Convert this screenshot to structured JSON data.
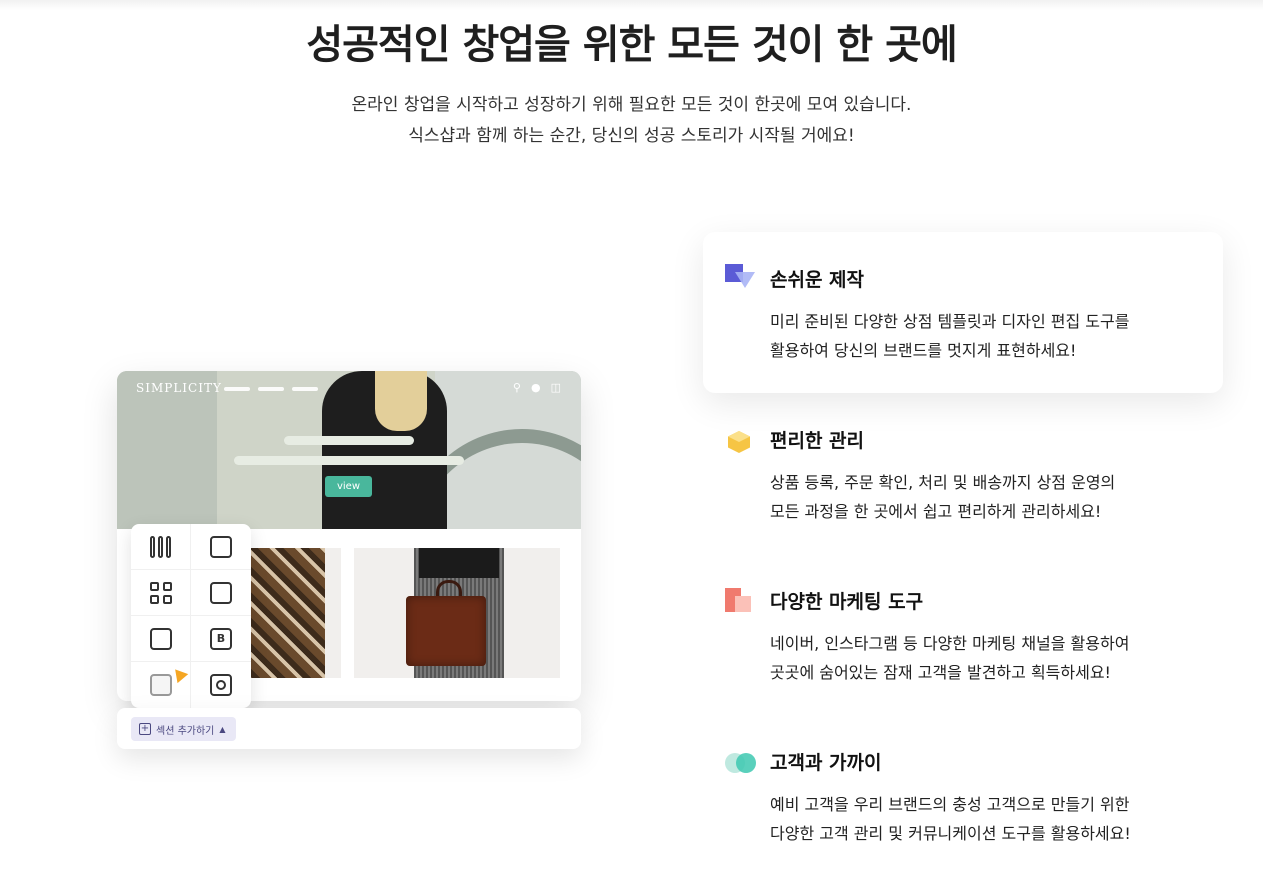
{
  "hero": {
    "title": "성공적인 창업을 위한 모든 것이 한 곳에",
    "subtitle_line1": "온라인 창업을 시작하고 성장하기 위해 필요한 모든 것이 한곳에 모여 있습니다.",
    "subtitle_line2": "식스샵과 함께 하는 순간, 당신의 성공 스토리가 시작될 거에요!"
  },
  "mockup": {
    "logo": "SIMPLICITY",
    "view_button": "view",
    "section_add_button": "섹션 추가하기",
    "tools": [
      "columns-icon",
      "card-icon",
      "grid-icon",
      "shirt-icon",
      "image-icon",
      "b-icon",
      "map-pin-icon",
      "instagram-icon"
    ],
    "colors": {
      "accent": "#49b79c",
      "section_btn_bg": "#e9e8f6"
    }
  },
  "features": [
    {
      "icon": "layers-icon",
      "title": "손쉬운 제작",
      "desc_line1": "미리 준비된 다양한 상점 템플릿과 디자인 편집 도구를",
      "desc_line2": "활용하여 당신의 브랜드를 멋지게 표현하세요!"
    },
    {
      "icon": "box-icon",
      "title": "편리한 관리",
      "desc_line1": "상품 등록, 주문 확인, 처리 및 배송까지 상점 운영의",
      "desc_line2": "모든 과정을 한 곳에서 쉽고 편리하게 관리하세요!"
    },
    {
      "icon": "marketing-icon",
      "title": "다양한 마케팅 도구",
      "desc_line1": "네이버, 인스타그램 등 다양한 마케팅 채널을 활용하여",
      "desc_line2": "곳곳에 숨어있는 잠재 고객을 발견하고 획득하세요!"
    },
    {
      "icon": "customers-icon",
      "title": "고객과 가까이",
      "desc_line1": "예비 고객을 우리 브랜드의 충성 고객으로 만들기 위한",
      "desc_line2": "다양한 고객 관리 및 커뮤니케이션 도구를 활용하세요!"
    }
  ]
}
